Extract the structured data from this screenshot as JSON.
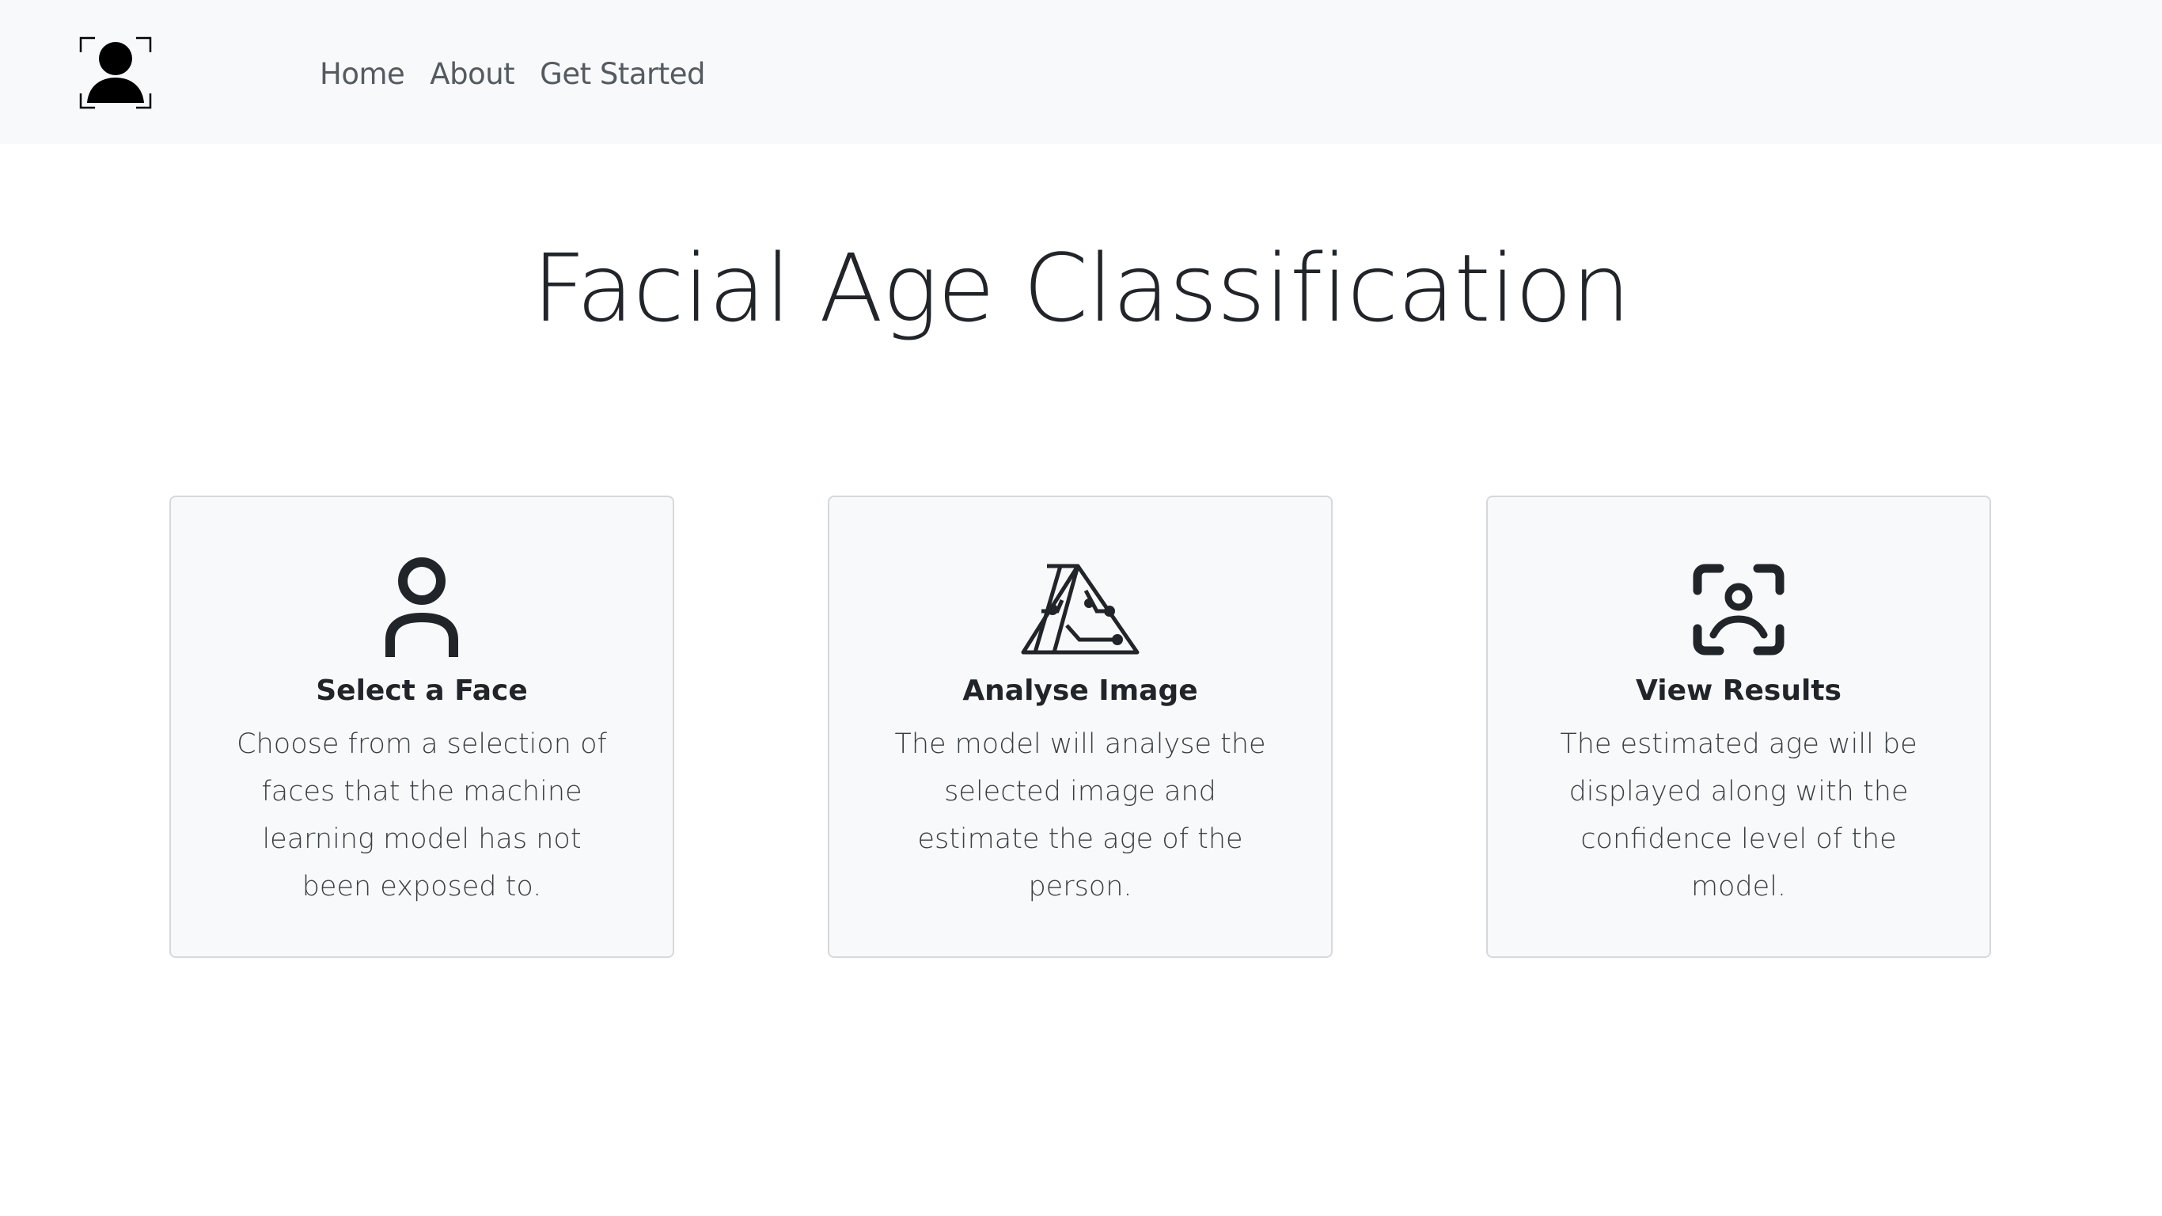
{
  "navbar": {
    "brand_icon": "face-scan-logo-icon",
    "links": [
      {
        "label": "Home"
      },
      {
        "label": "About"
      },
      {
        "label": "Get Started"
      }
    ]
  },
  "hero": {
    "title": "Facial Age Classification"
  },
  "steps": [
    {
      "icon": "person-icon",
      "title": "Select a Face",
      "text": "Choose from a selection of faces that the machine learning model has not been exposed to."
    },
    {
      "icon": "ai-model-icon",
      "title": "Analyse Image",
      "text": "The model will analyse the selected image and estimate the age of the person."
    },
    {
      "icon": "face-scan-icon",
      "title": "View Results",
      "text": "The estimated age will be displayed along with the confidence level of the model."
    }
  ],
  "colors": {
    "navbar_bg": "#f8f9fa",
    "card_bg": "#f8f9fa",
    "card_border": "#d6d9dc",
    "text": "#212529"
  }
}
